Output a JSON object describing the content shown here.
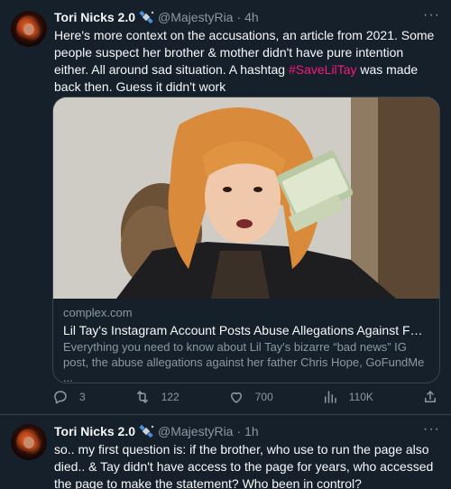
{
  "tweets": [
    {
      "name": "Tori Nicks 2.0",
      "handle": "@MajestyRia",
      "time": "4h",
      "text_before": "Here's more context on the accusations, an article from 2021. Some people suspect her brother & mother didn't have pure intention either. All around sad situation. A hashtag ",
      "hashtag": "#SaveLilTay",
      "text_after": " was made back then. Guess it didn't work",
      "card": {
        "domain": "complex.com",
        "title": "Lil Tay's Instagram Account Posts Abuse Allegations Against Father, P...",
        "description": "Everything you need to know about Lil Tay's bizarre “bad news” IG post, the abuse allegations against her father Chris Hope, GoFundMe ..."
      },
      "actions": {
        "replies": "3",
        "retweets": "122",
        "likes": "700",
        "views": "110K"
      }
    },
    {
      "name": "Tori Nicks 2.0",
      "handle": "@MajestyRia",
      "time": "1h",
      "text": "so.. my first question is: if the brother, who use to run the page also died.. & Tay didn't have access to the page for years, who accessed the page to make the statement? Who been in control?"
    }
  ],
  "more_label": "···",
  "separator": "·",
  "colors": {
    "background": "#15202b",
    "text": "#f7f9f9",
    "secondary": "#8b98a5",
    "hashtag": "#f91880",
    "border": "#38444d"
  },
  "icons": [
    "satellite-badge-icon",
    "more-icon",
    "reply-icon",
    "retweet-icon",
    "like-icon",
    "views-icon",
    "share-icon"
  ]
}
